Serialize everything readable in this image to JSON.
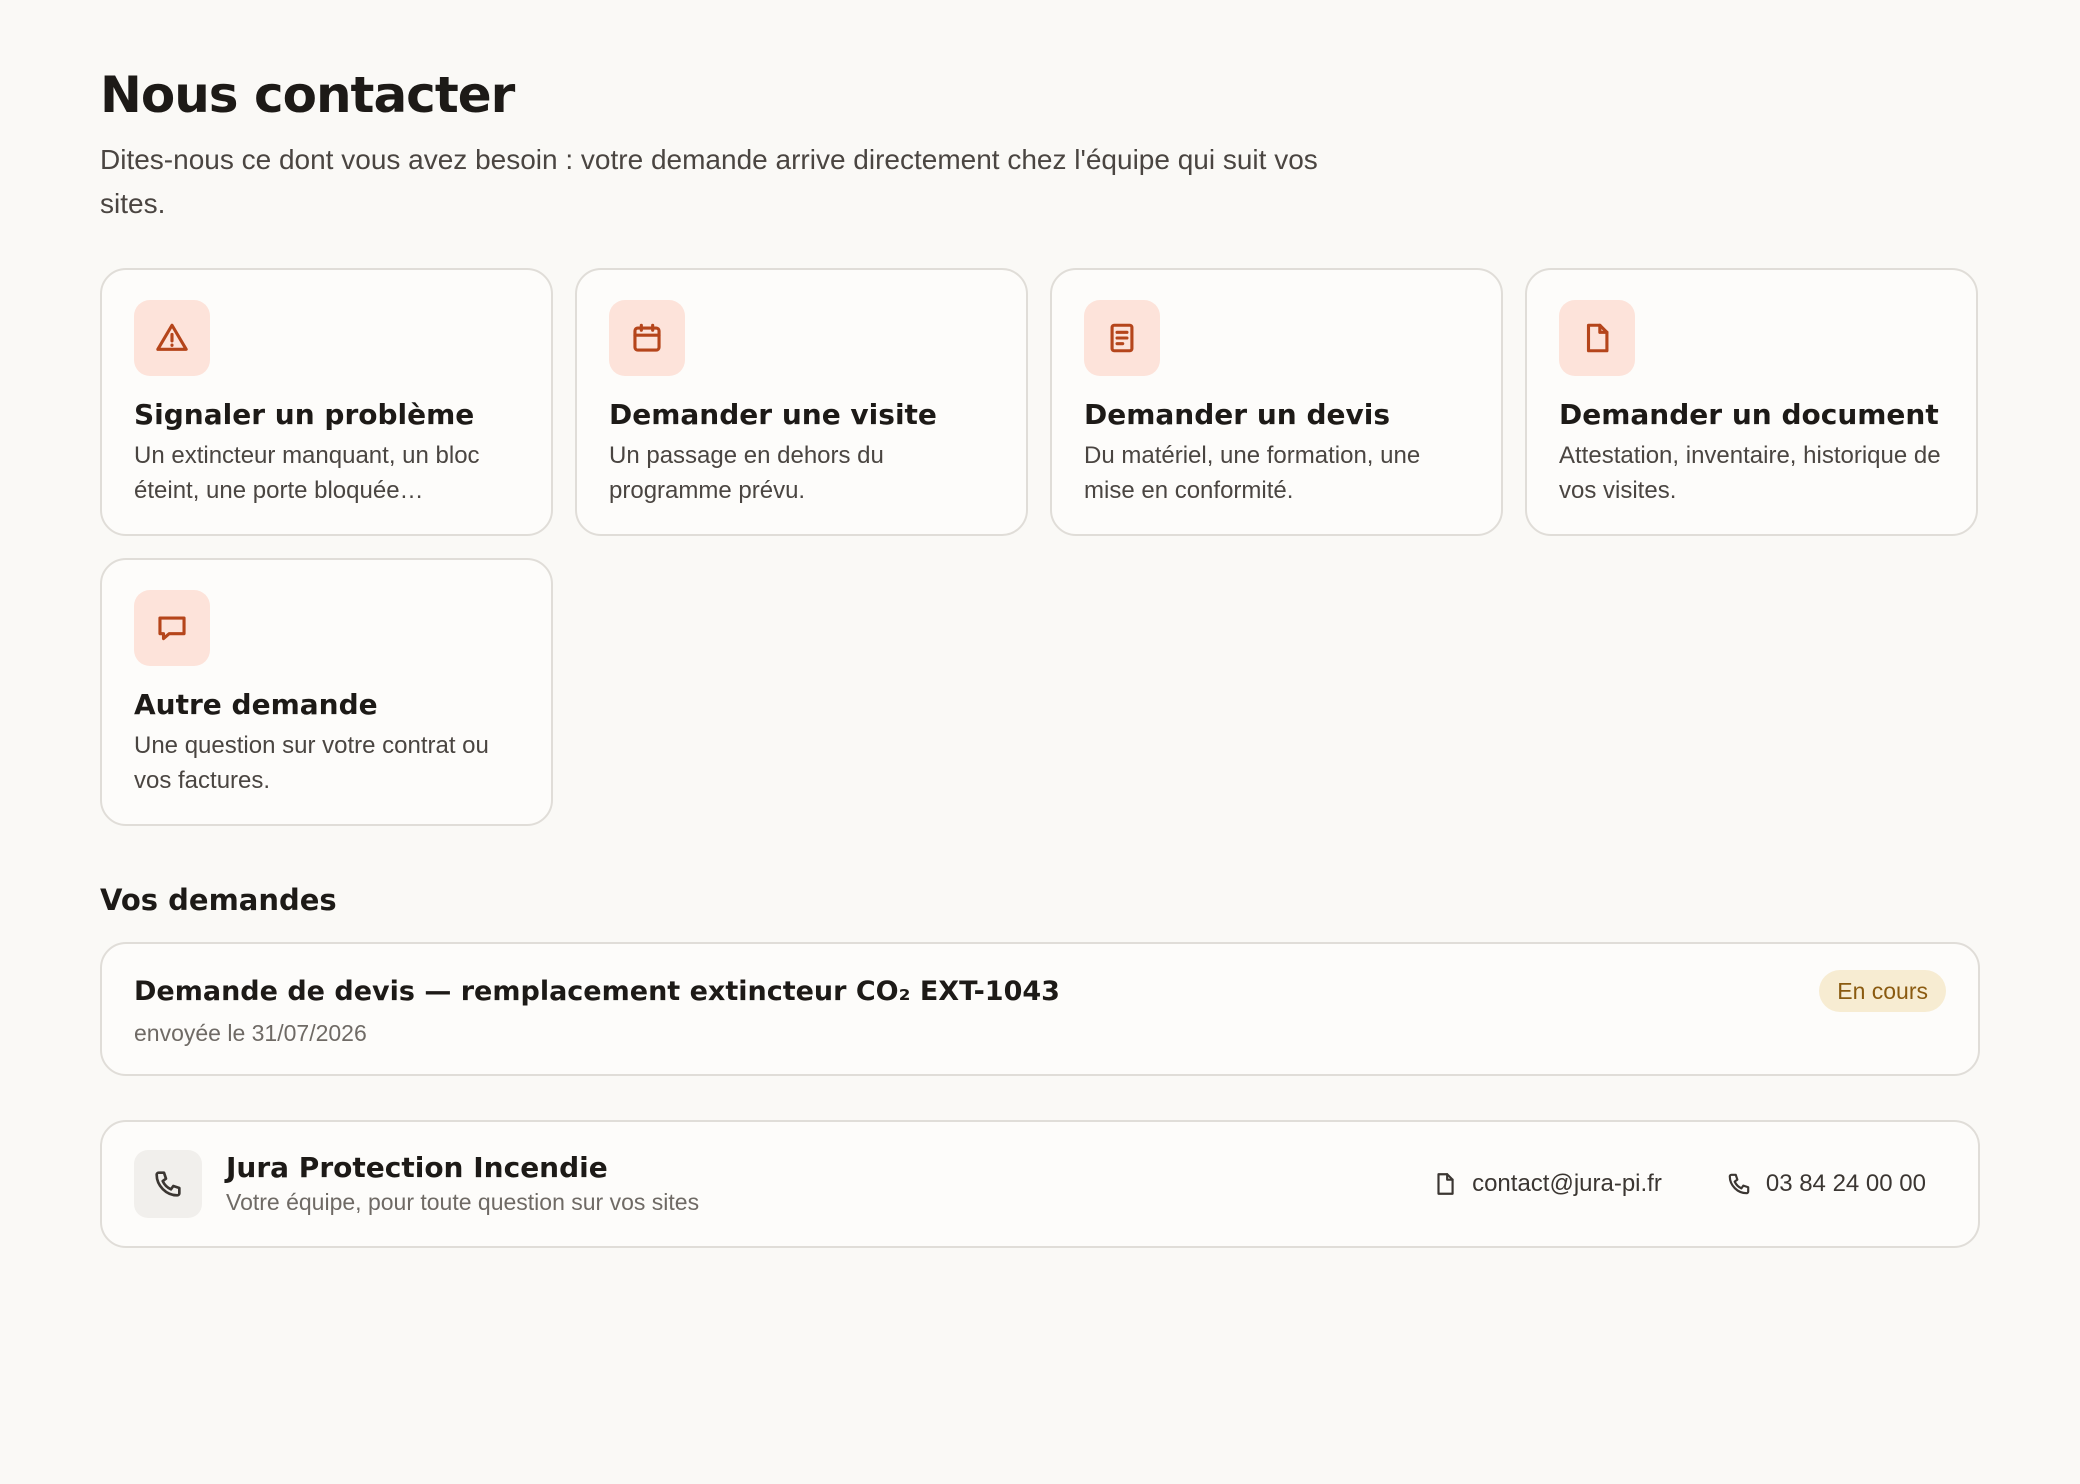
{
  "header": {
    "title": "Nous contacter",
    "subtitle": "Dites-nous ce dont vous avez besoin : votre demande arrive directement chez l'équipe qui suit vos sites."
  },
  "cards": [
    {
      "icon": "warning-icon",
      "title": "Signaler un problème",
      "description": "Un extincteur manquant, un bloc éteint, une porte bloquée…"
    },
    {
      "icon": "calendar-icon",
      "title": "Demander une visite",
      "description": "Un passage en dehors du programme prévu."
    },
    {
      "icon": "receipt-icon",
      "title": "Demander un devis",
      "description": "Du matériel, une formation, une mise en conformité."
    },
    {
      "icon": "document-icon",
      "title": "Demander un document",
      "description": "Attestation, inventaire, historique de vos visites."
    },
    {
      "icon": "chat-icon",
      "title": "Autre demande",
      "description": "Une question sur votre contrat ou vos factures."
    }
  ],
  "requests": {
    "section_title": "Vos demandes",
    "items": [
      {
        "title": "Demande de devis — remplacement extincteur CO₂ EXT-1043",
        "date": "envoyée le 31/07/2026",
        "status": "En cours"
      }
    ]
  },
  "contact": {
    "icon": "phone-icon",
    "name": "Jura Protection Incendie",
    "tagline": "Votre équipe, pour toute question sur vos sites",
    "email": "contact@jura-pi.fr",
    "phone": "03 84 24 00 00"
  },
  "colors": {
    "accent": "#b5451b",
    "accent_bg": "#fde3da",
    "status_bg": "#f7ecd2",
    "status_text": "#8a5a10"
  }
}
